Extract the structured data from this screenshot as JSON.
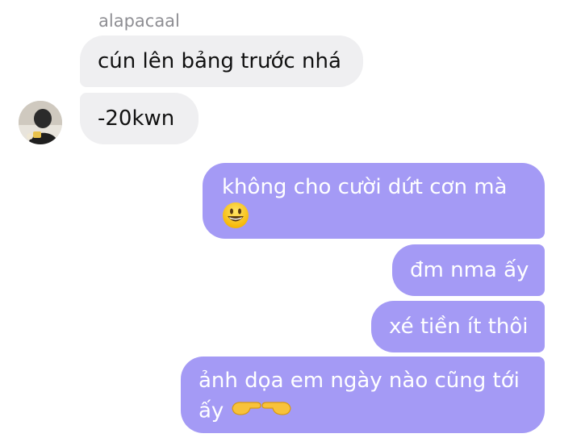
{
  "thread": {
    "sender_name": "alapacaal",
    "incoming": [
      {
        "text": "cún lên bảng trước nhá"
      },
      {
        "text": "-20kwn"
      }
    ],
    "outgoing": [
      {
        "text": "không cho cười dứt cơn mà",
        "emoji": "grinning-face-emoji"
      },
      {
        "text": "đm nma ấy"
      },
      {
        "text": "xé tiền ít thôi"
      },
      {
        "text": "ảnh dọa em ngày nào cũng tới ấy",
        "emoji": "pointing-fingers-together-emoji"
      }
    ]
  },
  "colors": {
    "incoming_bubble": "#efeff1",
    "outgoing_bubble": "#a49af5",
    "outgoing_text": "#ffffff",
    "sender_name": "#8e8e93"
  }
}
